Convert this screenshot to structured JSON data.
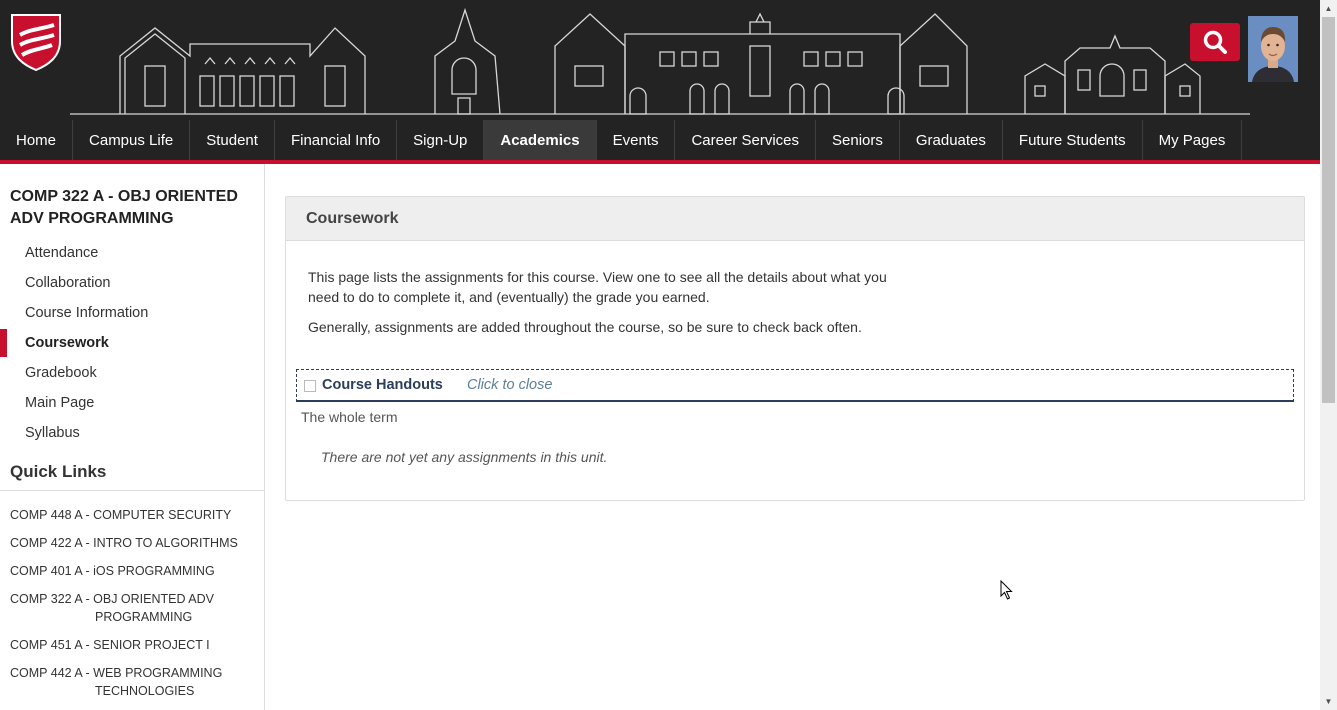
{
  "header": {
    "search_label": "",
    "colors": {
      "background": "#232323",
      "accent": "#c8102e"
    }
  },
  "nav": {
    "items": [
      {
        "label": "Home"
      },
      {
        "label": "Campus Life"
      },
      {
        "label": "Student"
      },
      {
        "label": "Financial Info"
      },
      {
        "label": "Sign-Up"
      },
      {
        "label": "Academics",
        "active": true
      },
      {
        "label": "Events"
      },
      {
        "label": "Career Services"
      },
      {
        "label": "Seniors"
      },
      {
        "label": "Graduates"
      },
      {
        "label": "Future Students"
      },
      {
        "label": "My Pages"
      }
    ]
  },
  "sidebar": {
    "course_title": "COMP 322 A - OBJ ORIENTED ADV PROGRAMMING",
    "menu": [
      {
        "label": "Attendance"
      },
      {
        "label": "Collaboration"
      },
      {
        "label": "Course Information"
      },
      {
        "label": "Coursework",
        "active": true
      },
      {
        "label": "Gradebook"
      },
      {
        "label": "Main Page"
      },
      {
        "label": "Syllabus"
      }
    ],
    "quick_links_heading": "Quick Links",
    "quick_links": [
      {
        "label": "COMP 448 A - COMPUTER SECURITY"
      },
      {
        "label": "COMP 422 A - INTRO TO ALGORITHMS"
      },
      {
        "label": "COMP 401 A - iOS PROGRAMMING"
      },
      {
        "label": "COMP 322 A - OBJ ORIENTED ADV PROGRAMMING"
      },
      {
        "label": "COMP 451 A - SENIOR PROJECT I"
      },
      {
        "label": "COMP 442 A - WEB PROGRAMMING TECHNOLOGIES"
      }
    ]
  },
  "main": {
    "panel_title": "Coursework",
    "intro_1": "This page lists the assignments for this course. View one to see all the details about what you need to do to complete it, and (eventually) the grade you earned.",
    "intro_2": "Generally, assignments are added throughout the course, so be sure to check back often.",
    "unit": {
      "title": "Course Handouts",
      "toggle_label": "Click to close",
      "period": "The whole term",
      "empty_message": "There are not yet any assignments in this unit."
    }
  },
  "icons": {
    "logo": "shield-logo-icon",
    "search": "search-icon",
    "avatar": "user-avatar",
    "scroll_up": "scroll-up-arrow-icon",
    "scroll_down": "scroll-down-arrow-icon",
    "cursor": "mouse-pointer-icon"
  }
}
